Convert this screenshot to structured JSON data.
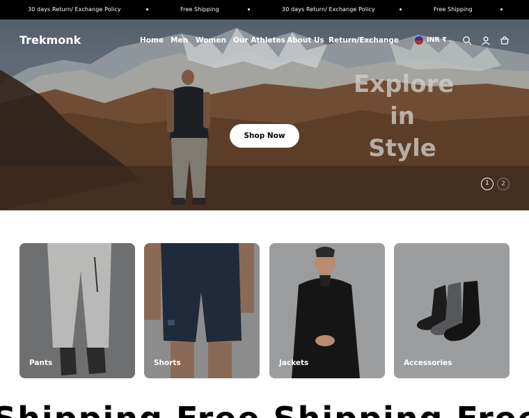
{
  "announcement": {
    "items": [
      "30 days Return/ Exchange Policy",
      "Free Shipping",
      "30 days Return/ Exchange Policy",
      "Free Shipping"
    ]
  },
  "header": {
    "logo": "Trekmonk",
    "nav": [
      "Home",
      "Men",
      "Women",
      "Our Athletes",
      "About Us",
      "Return/Exchange"
    ],
    "currency": "INR ₹",
    "icons": [
      "flag-icon",
      "chevron-down-icon",
      "search-icon",
      "account-icon",
      "cart-icon"
    ]
  },
  "hero": {
    "headline": [
      "Explore",
      "in",
      "Style"
    ],
    "cta": "Shop Now",
    "slides": [
      "1",
      "2"
    ],
    "active_slide": 1
  },
  "categories": [
    {
      "label": "Pants"
    },
    {
      "label": "Shorts"
    },
    {
      "label": "Jackets"
    },
    {
      "label": "Accessories"
    }
  ],
  "marquee": {
    "text": "Shipping  Free Shipping  Free"
  }
}
